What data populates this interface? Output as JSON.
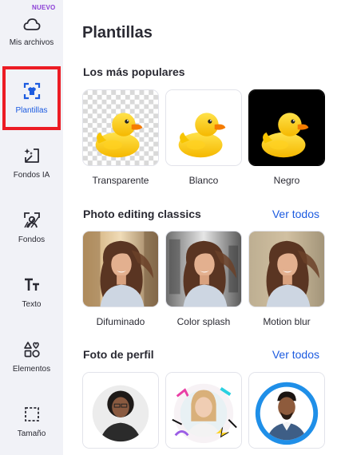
{
  "sidebar": {
    "badge": "NUEVO",
    "items": [
      {
        "label": "Mis archivos"
      },
      {
        "label": "Plantillas"
      },
      {
        "label": "Fondos IA"
      },
      {
        "label": "Fondos"
      },
      {
        "label": "Texto"
      },
      {
        "label": "Elementos"
      },
      {
        "label": "Tamaño"
      }
    ]
  },
  "main": {
    "title": "Plantillas",
    "sections": [
      {
        "title": "Los más populares",
        "items": [
          {
            "label": "Transparente"
          },
          {
            "label": "Blanco"
          },
          {
            "label": "Negro"
          }
        ]
      },
      {
        "title": "Photo editing classics",
        "see_all": "Ver todos",
        "items": [
          {
            "label": "Difuminado"
          },
          {
            "label": "Color splash"
          },
          {
            "label": "Motion blur"
          }
        ]
      },
      {
        "title": "Foto de perfil",
        "see_all": "Ver todos",
        "items": [
          {},
          {},
          {}
        ]
      }
    ]
  },
  "colors": {
    "accent": "#1c5be0",
    "highlight": "#ec1c24",
    "sidebar_bg": "#f1f2f7",
    "badge": "#8b3fd6"
  }
}
